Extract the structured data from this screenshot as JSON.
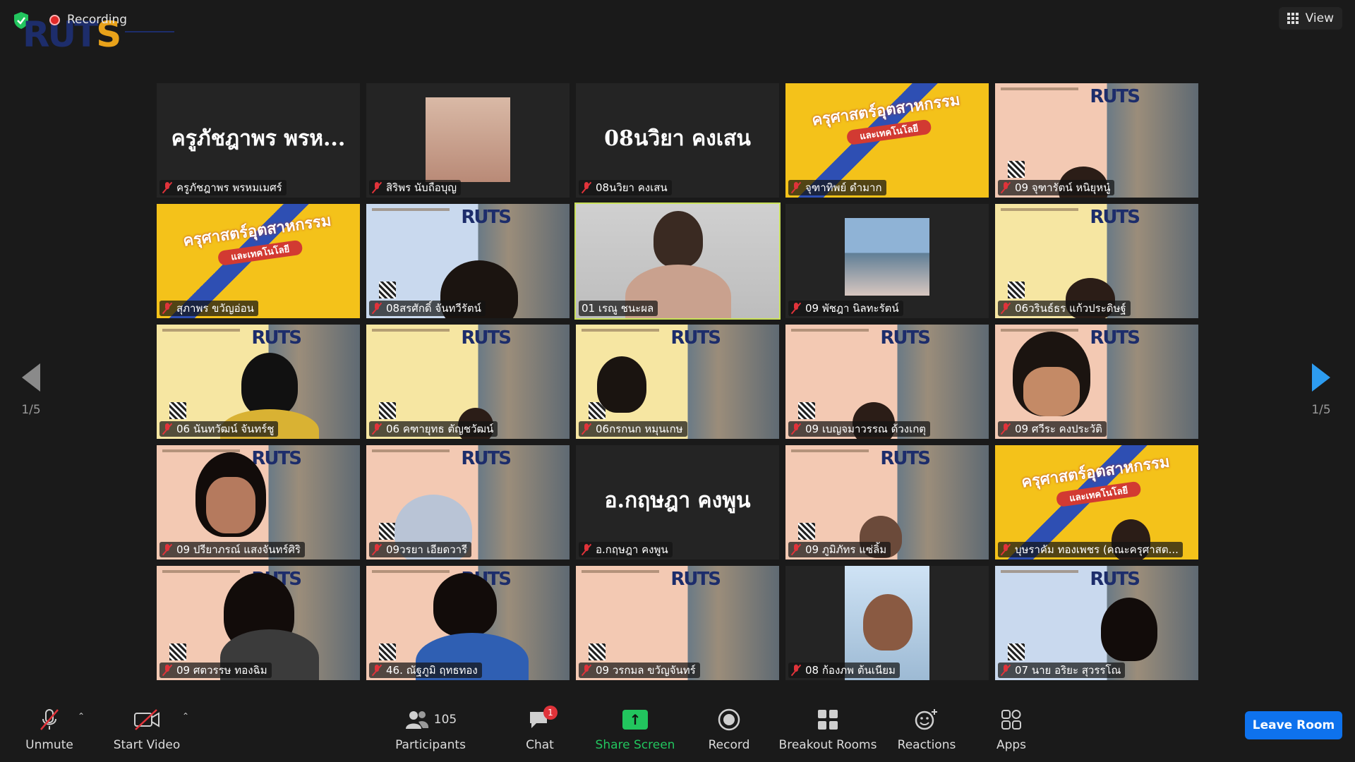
{
  "top": {
    "recording_label": "Recording",
    "logo_text": "RUTS",
    "view_label": "View"
  },
  "pager": {
    "left": "1/5",
    "right": "1/5"
  },
  "tiles": [
    {
      "name": "ครูภัชฎาพร  พรหมเมศร์",
      "big": "ครูภัชฎาพร  พรห..."
    },
    {
      "name": "สิริพร นับถือบุญ"
    },
    {
      "name": "08นวิยา คงเสน",
      "big": "08นวิยา คงเสน"
    },
    {
      "name": "จุฑาทิพย์  ดำมาก"
    },
    {
      "name": "09 จุฑารัตน์ หนิยุหนู๋"
    },
    {
      "name": "สุภาพร ขวัญอ่อน"
    },
    {
      "name": "08สรศักดิ์ จันทวีรัตน์"
    },
    {
      "name": "01 เรณู  ชนะผล"
    },
    {
      "name": "09 พัชฎา นิลทะรัตน์"
    },
    {
      "name": "06วรินธ์ธร แก้วประดิษฐ์"
    },
    {
      "name": "06 นันทวัฒน์ จันทร์ชู"
    },
    {
      "name": "06 คฑายุทธ ตัญชวัฒน์"
    },
    {
      "name": "06กรกนก หมุนเกษ"
    },
    {
      "name": "09 เบญจมาวรรณ ด้วงเกตุ"
    },
    {
      "name": "09 ศวีระ คงประวัติ"
    },
    {
      "name": "09 ปรียาภรณ์ แสงจันทร์ศิริ"
    },
    {
      "name": "09วรยา เอียดวารี"
    },
    {
      "name": "อ.กฤษฎา คงพูน",
      "big": "อ.กฤษฎา คงพูน"
    },
    {
      "name": "09 ภูมิภัทร แซ่ลิ้ม"
    },
    {
      "name": "บุษราคัม ทองเพชร (คณะครุศาสต..."
    },
    {
      "name": "09 ศตวรรษ ทองฉิม"
    },
    {
      "name": "46. ณัฐภูมิ ฤทธทอง"
    },
    {
      "name": "09 วรกมล ขวัญจันทร์"
    },
    {
      "name": "08 ก้องภพ ต้นเนียม"
    },
    {
      "name": "07 นาย อริยะ สุวรรโณ"
    }
  ],
  "banner": {
    "title": "ครุศาสตร์อุตสาหกรรม",
    "sub": "และเทคโนโลยี"
  },
  "toolbar": {
    "unmute": "Unmute",
    "start_video": "Start Video",
    "participants": "Participants",
    "participants_count": "105",
    "chat": "Chat",
    "chat_badge": "1",
    "share_screen": "Share Screen",
    "record": "Record",
    "breakout_rooms": "Breakout Rooms",
    "reactions": "Reactions",
    "apps": "Apps",
    "leave_room": "Leave Room"
  },
  "colors": {
    "accent_blue": "#0e72ed",
    "share_green": "#22c55e",
    "mic_red": "#e0333a",
    "speaker_outline": "#c9e05a"
  }
}
